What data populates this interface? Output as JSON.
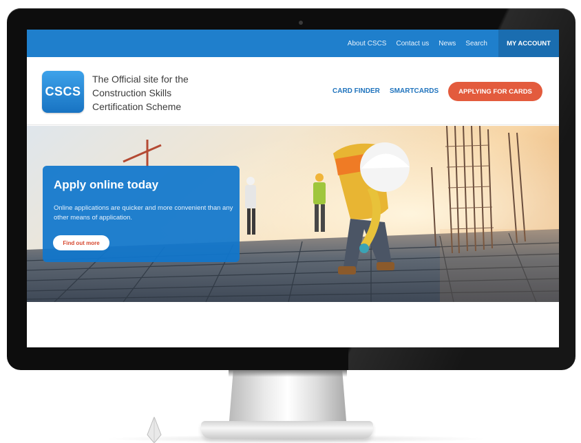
{
  "topbar": {
    "links": [
      "About CSCS",
      "Contact us",
      "News",
      "Search"
    ],
    "account_label": "MY ACCOUNT"
  },
  "header": {
    "logo_text": "CSCS",
    "tagline": [
      "The Official site for the",
      "Construction Skills",
      "Certification Scheme"
    ],
    "nav": [
      "CARD FINDER",
      "SMARTCARDS"
    ],
    "cta_label": "APPLYING FOR CARDS"
  },
  "hero": {
    "title": "Apply online today",
    "text": "Online applications are quicker and more convenient than any other means of application.",
    "button_label": "Find out more"
  },
  "colors": {
    "brand_blue": "#1f7fcc",
    "account_blue": "#1a6db0",
    "cta_orange": "#e35b3d",
    "nav_blue": "#1f73bd"
  },
  "icons": {
    "logo": "cscs-logo-icon",
    "camera": "webcam-icon"
  }
}
